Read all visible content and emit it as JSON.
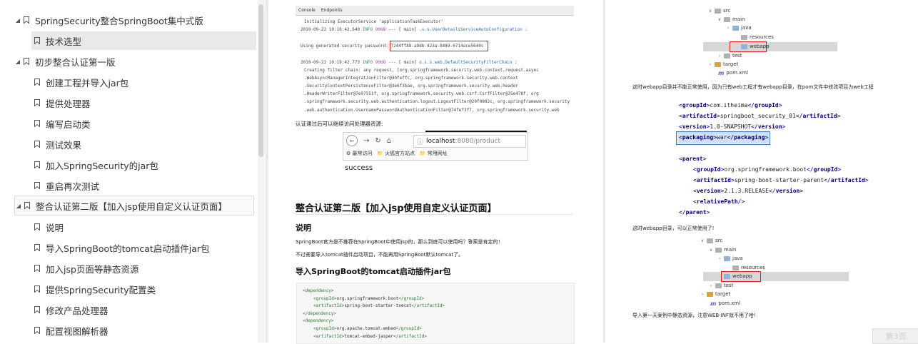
{
  "toc": {
    "items": [
      {
        "label": "SpringSecurity整合SpringBoot集中式版",
        "level": 0,
        "expanded": true
      },
      {
        "label": "技术选型",
        "level": 1,
        "selected": true
      },
      {
        "label": "初步整合认证第一版",
        "level": 0,
        "expanded": true
      },
      {
        "label": "创建工程并导入jar包",
        "level": 1
      },
      {
        "label": "提供处理器",
        "level": 1
      },
      {
        "label": "编写启动类",
        "level": 1
      },
      {
        "label": "测试效果",
        "level": 1
      },
      {
        "label": "加入SpringSecurity的jar包",
        "level": 1
      },
      {
        "label": "重启再次测试",
        "level": 1
      },
      {
        "label": "整合认证第二版【加入jsp使用自定义认证页面】",
        "level": 0,
        "expanded": true,
        "boxed": true
      },
      {
        "label": "说明",
        "level": 1
      },
      {
        "label": "导入SpringBoot的tomcat启动插件jar包",
        "level": 1
      },
      {
        "label": "加入jsp页面等静态资源",
        "level": 1
      },
      {
        "label": "提供SpringSecurity配置类",
        "level": 1
      },
      {
        "label": "修改产品处理器",
        "level": 1
      },
      {
        "label": "配置视图解析器",
        "level": 1
      }
    ]
  },
  "console": {
    "tabs": [
      "Console",
      "Endpoints"
    ],
    "lines": [
      "Initializing ExecutorService 'applicationTaskExecutor'",
      "2019-09-22 10:19:42.649  INFO 9068 --- [           main] .s.s.UserDetailsServiceAutoConfiguration :",
      "",
      "Using generated security password: ",
      "",
      "2019-09-22 10:19:42.773  INFO 9068 --- [           main] o.s.s.web.DefaultSecurityFilterChain     :",
      "Creating filter chain: any request, [org.springframework.security.web.context.request.async",
      ".WebAsyncManagerIntegrationFilter@30feffc, org.springframework.security.web.context",
      ".SecurityContextPersistenceFilter@3e6f3bae, org.springframework.security.web.header",
      ".HeaderWriterFilter@7e97551f, org.springframework.security.web.csrf.CsrfFilter@35e478f, org",
      ".springframework.security.web.authentication.logout.LogoutFilter@29f0802c, org.springframework.security",
      ".web.authentication.UsernamePasswordAuthenticationFilter@74fef3f7, org.springframework.security.web"
    ],
    "password": "7244ff88-a9db-423a-8489-0714ace5640c"
  },
  "middle": {
    "auth_note": "认证通过后可以继续访问处理器资源:",
    "browser": {
      "url_host": "localhost",
      "url_path": ":8080/product",
      "bookmarks": [
        "最常访问",
        "火狐官方站点",
        "常用网址"
      ]
    },
    "success_text": "success",
    "section_title": "整合认证第二版【加入jsp使用自定义认证页面】",
    "sub_title_1": "说明",
    "para_1": "SpringBoot官方是不推荐在SpringBoot中使用jsp的，那么到底可以使用吗？答案是肯定的！",
    "para_2": "不过需要导入tomcat插件启动项目，不能再用SpringBoot默认tomcat了。",
    "sub_title_2": "导入SpringBoot的tomcat启动插件jar包",
    "code_lines": [
      {
        "indent": 0,
        "open": "<dependency>",
        "text": "",
        "close": ""
      },
      {
        "indent": 1,
        "open": "<groupId>",
        "text": "org.springframework.boot",
        "close": "</groupId>"
      },
      {
        "indent": 1,
        "open": "<artifactId>",
        "text": "spring-boot-starter-tomcat",
        "close": "</artifactId>"
      },
      {
        "indent": 0,
        "open": "</dependency>",
        "text": "",
        "close": ""
      },
      {
        "indent": 0,
        "open": "<dependency>",
        "text": "",
        "close": ""
      },
      {
        "indent": 1,
        "open": "<groupId>",
        "text": "org.apache.tomcat.embed",
        "close": "</groupId>"
      },
      {
        "indent": 1,
        "open": "<artifactId>",
        "text": "tomcat-embed-jasper",
        "close": "</artifactId>"
      }
    ]
  },
  "right": {
    "tree1": [
      "src",
      "main",
      "java",
      "resources",
      "webapp",
      "test",
      "target",
      "pom.xml"
    ],
    "note1": "这时webapp目录并不能正常使用，因为只有web工程才有webapp目录，在pom文件中修改项目为web工程",
    "xml_lines": [
      {
        "indent": 0,
        "tag": "groupId",
        "text": "com.itheima"
      },
      {
        "indent": 0,
        "tag": "artifactId",
        "text": "springboot_security_01"
      },
      {
        "indent": 0,
        "tag": "version",
        "text": "1.0-SNAPSHOT"
      },
      {
        "indent": 0,
        "tag": "packaging",
        "text": "war"
      },
      {
        "indent": 0,
        "tag": "",
        "text": ""
      },
      {
        "indent": 0,
        "tag": "parent",
        "text": "",
        "open_only": true
      },
      {
        "indent": 1,
        "tag": "groupId",
        "text": "org.springframework.boot"
      },
      {
        "indent": 1,
        "tag": "artifactId",
        "text": "spring-boot-starter-parent"
      },
      {
        "indent": 1,
        "tag": "version",
        "text": "2.1.3.RELEASE"
      },
      {
        "indent": 1,
        "tag": "relativePath",
        "text": "",
        "self_close": true
      },
      {
        "indent": 0,
        "tag": "parent",
        "text": "",
        "close_only": true
      }
    ],
    "note2": "这时webapp目录，可以正常使用了!",
    "tree2": [
      "src",
      "main",
      "java",
      "resources",
      "webapp",
      "test",
      "target",
      "pom.xml"
    ],
    "note3": "导入第一天案例中静态资源，注意WEB-INF就不用了哈!"
  },
  "page_button": "第3页",
  "colors": {
    "highlight_red": "#e02020",
    "xml_tag": "#00007f",
    "code_tag": "#2e7d32"
  }
}
